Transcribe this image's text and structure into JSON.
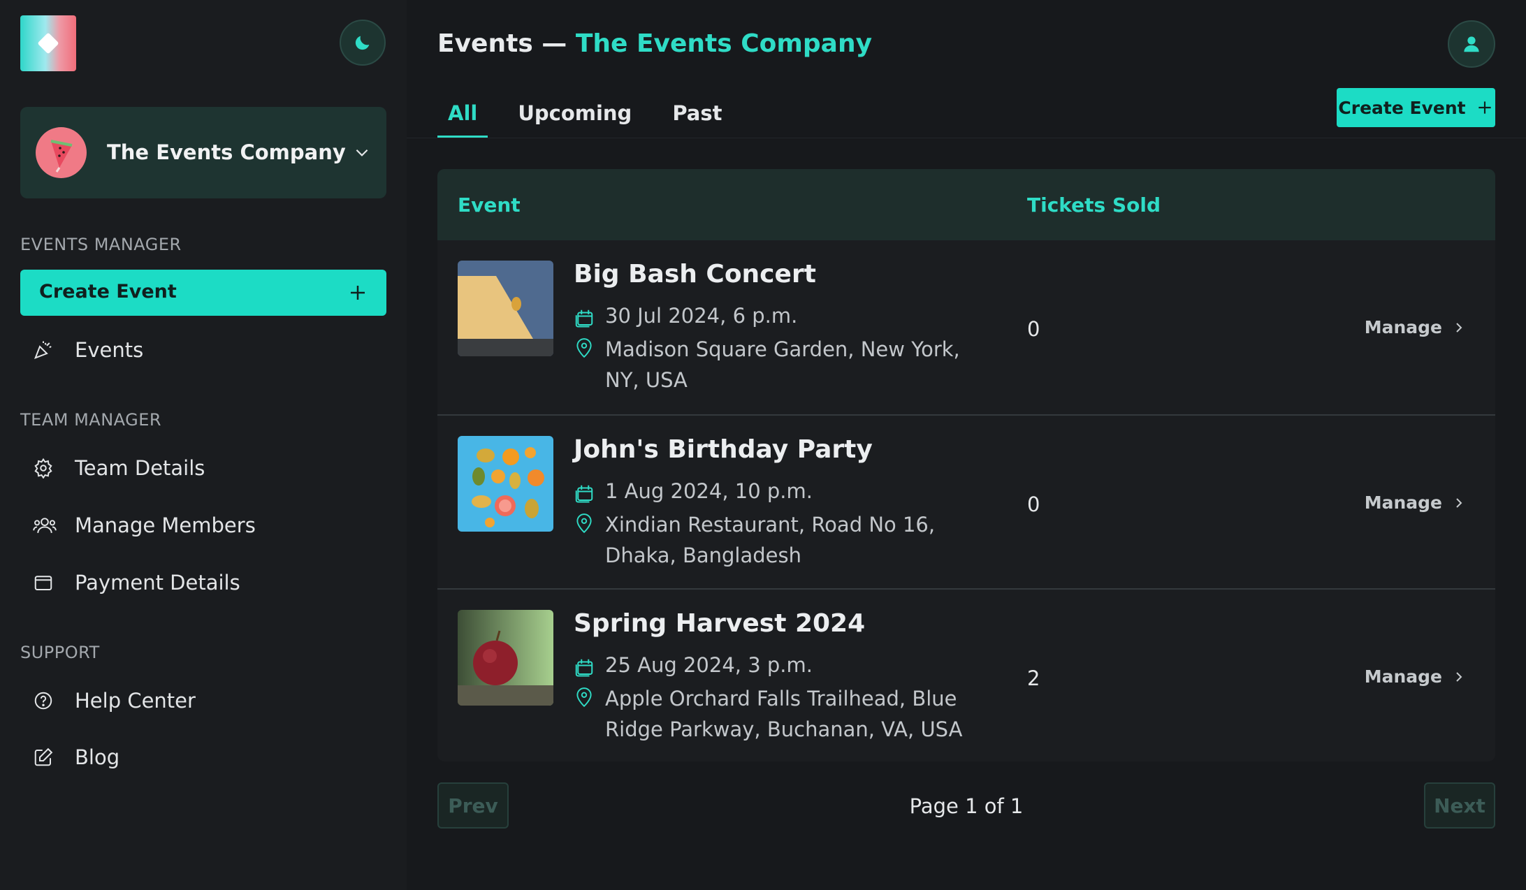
{
  "app": {
    "theme_icon": "moon-icon",
    "logo_icon": "diamond-logo"
  },
  "sidebar": {
    "team_selector": {
      "name": "The Events Company",
      "icon": "chevron-down-icon"
    },
    "sections": {
      "events_manager": "EVENTS MANAGER",
      "team_manager": "TEAM MANAGER",
      "support": "SUPPORT"
    },
    "create_event_label": "Create Event",
    "items": {
      "events": "Events",
      "team_details": "Team Details",
      "manage_members": "Manage Members",
      "payment_details": "Payment Details",
      "help_center": "Help Center",
      "blog": "Blog"
    }
  },
  "header": {
    "title_prefix": "Events — ",
    "title_team": "The Events Company",
    "user_icon": "user-icon"
  },
  "tabs": [
    "All",
    "Upcoming",
    "Past"
  ],
  "active_tab": "All",
  "create_event_label": "Create Event",
  "table": {
    "columns": [
      "Event",
      "Tickets Sold"
    ],
    "rows": [
      {
        "title": "Big Bash Concert",
        "date": "30 Jul 2024, 6 p.m.",
        "location": "Madison Square Garden, New York, NY, USA",
        "tickets_sold": "0",
        "action": "Manage"
      },
      {
        "title": "John's Birthday Party",
        "date": "1 Aug 2024, 10 p.m.",
        "location": "Xindian Restaurant, Road No 16, Dhaka, Bangladesh",
        "tickets_sold": "0",
        "action": "Manage"
      },
      {
        "title": "Spring Harvest 2024",
        "date": "25 Aug 2024, 3 p.m.",
        "location": "Apple Orchard Falls Trailhead, Blue Ridge Parkway, Buchanan, VA, USA",
        "tickets_sold": "2",
        "action": "Manage"
      }
    ]
  },
  "pagination": {
    "prev_label": "Prev",
    "next_label": "Next",
    "page_info": "Page 1 of 1"
  },
  "colors": {
    "accent": "#1cdcc5",
    "background": "#17191c",
    "sidebar": "#1a1c1f"
  }
}
